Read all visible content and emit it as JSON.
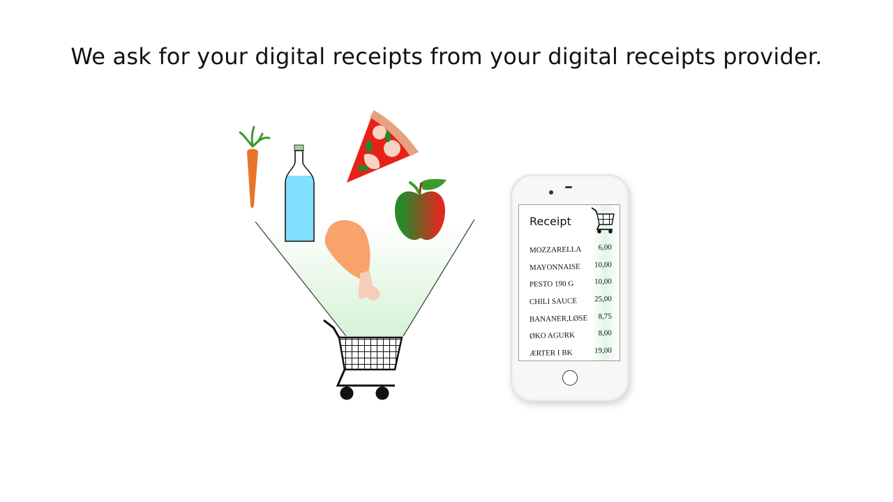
{
  "slide": {
    "title": "We ask for your digital receipts from your digital receipts provider."
  },
  "illustration": {
    "icons": [
      "carrot-icon",
      "bottle-icon",
      "pizza-slice-icon",
      "apple-icon",
      "chicken-leg-icon",
      "shopping-cart-icon"
    ],
    "colors": {
      "carrot": "#e8742a",
      "leaf": "#3a9a2a",
      "bottle_water": "#7fe0ff",
      "bottle_cap": "#9fd49a",
      "pizza_crust": "#e6a27f",
      "pizza_sauce": "#e8201a",
      "pizza_cheese": "#f6d3c2",
      "apple_green": "#2a8a2a",
      "apple_red": "#e02a20",
      "chicken": "#f7a36a",
      "bone": "#f5cdb8",
      "beam": "#e6f7e6"
    }
  },
  "phone": {
    "receipt_title": "Receipt",
    "cart_icon": "shopping-cart-icon",
    "items": [
      {
        "name": "MOZZARELLA",
        "price": "6,00"
      },
      {
        "name": "MAYONNAISE",
        "price": "10,00"
      },
      {
        "name": "PESTO 190 G",
        "price": "10,00"
      },
      {
        "name": "CHILI SAUCE",
        "price": "25,00"
      },
      {
        "name": "BANANER,LØSE",
        "price": "8,75"
      },
      {
        "name": "ØKO AGURK",
        "price": "8,00"
      },
      {
        "name": "ÆRTER I BK",
        "price": "19,00"
      }
    ]
  }
}
